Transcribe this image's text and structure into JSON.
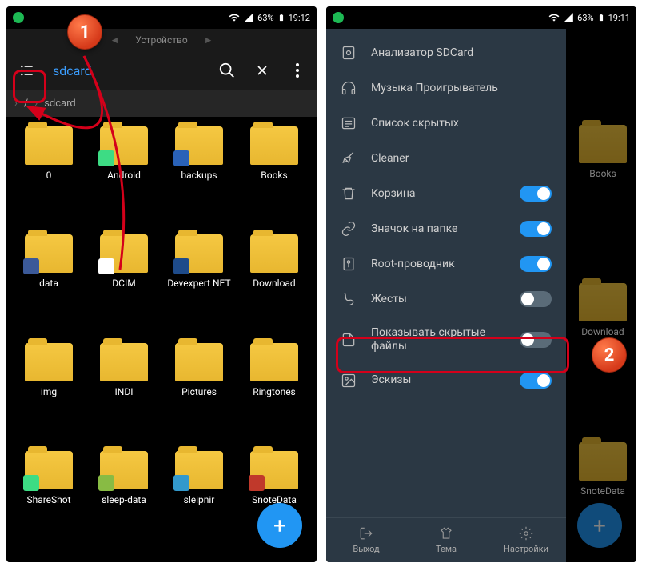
{
  "statusbar": {
    "battery": "63%",
    "time1": "19:12",
    "time2": "19:11"
  },
  "subheader": {
    "center": "Устройство"
  },
  "toolbar": {
    "title": "sdcard"
  },
  "breadcrumb": {
    "root": "/",
    "current": "sdcard"
  },
  "folders": [
    {
      "label": "0"
    },
    {
      "label": "Android"
    },
    {
      "label": "backups"
    },
    {
      "label": "Books"
    },
    {
      "label": "data"
    },
    {
      "label": "DCIM"
    },
    {
      "label": "Devexpert\nNET"
    },
    {
      "label": "Download"
    },
    {
      "label": "img"
    },
    {
      "label": "INDI"
    },
    {
      "label": "Pictures"
    },
    {
      "label": "Ringtones"
    },
    {
      "label": "ShareShot"
    },
    {
      "label": "sleep-data"
    },
    {
      "label": "sleipnir"
    },
    {
      "label": "SnoteData"
    }
  ],
  "folders2": [
    {
      "label": "Books"
    },
    {
      "label": "Download"
    },
    {
      "label": "SnoteData"
    }
  ],
  "drawer": {
    "items": [
      {
        "icon": "sd",
        "label": "Анализатор SDCard",
        "toggle": null
      },
      {
        "icon": "headphones",
        "label": "Музыка Проигрыватель",
        "toggle": null
      },
      {
        "icon": "list",
        "label": "Список скрытых",
        "toggle": null
      },
      {
        "icon": "broom",
        "label": "Cleaner",
        "toggle": null
      },
      {
        "icon": "trash",
        "label": "Корзина",
        "toggle": "on"
      },
      {
        "icon": "link",
        "label": "Значок на папке",
        "toggle": "on"
      },
      {
        "icon": "root",
        "label": "Root-проводник",
        "toggle": "on"
      },
      {
        "icon": "gesture",
        "label": "Жесты",
        "toggle": "off"
      },
      {
        "icon": "file",
        "label": "Показывать скрытые файлы",
        "toggle": "off"
      },
      {
        "icon": "thumb",
        "label": "Эскизы",
        "toggle": "on"
      }
    ],
    "bottom": [
      {
        "icon": "exit",
        "label": "Выход"
      },
      {
        "icon": "shirt",
        "label": "Тема"
      },
      {
        "icon": "gear",
        "label": "Настройки"
      }
    ]
  },
  "callouts": {
    "one": "1",
    "two": "2"
  }
}
